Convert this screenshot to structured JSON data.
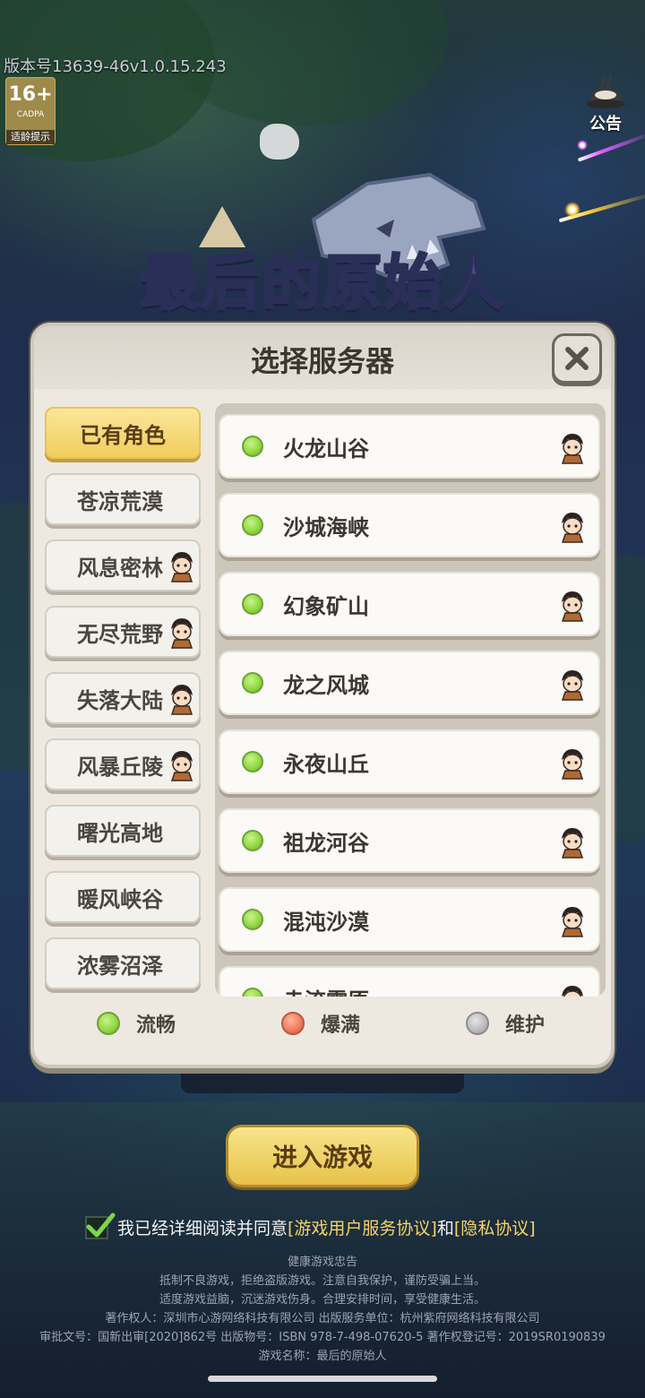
{
  "version": "版本号13639-46v1.0.15.243",
  "age_badge": {
    "rating": "16+",
    "org": "CADPA",
    "tip": "适龄提示"
  },
  "notice_label": "公告",
  "game_logo": "最后的原始人",
  "dialog": {
    "title": "选择服务器",
    "regions": [
      {
        "label": "已有角色",
        "active": true,
        "has_role": false
      },
      {
        "label": "苍凉荒漠",
        "active": false,
        "has_role": false
      },
      {
        "label": "风息密林",
        "active": false,
        "has_role": true
      },
      {
        "label": "无尽荒野",
        "active": false,
        "has_role": true
      },
      {
        "label": "失落大陆",
        "active": false,
        "has_role": true
      },
      {
        "label": "风暴丘陵",
        "active": false,
        "has_role": true
      },
      {
        "label": "曙光高地",
        "active": false,
        "has_role": false
      },
      {
        "label": "暖风峡谷",
        "active": false,
        "has_role": false
      },
      {
        "label": "浓雾沼泽",
        "active": false,
        "has_role": false
      }
    ],
    "servers": [
      {
        "name": "火龙山谷",
        "status": "流畅"
      },
      {
        "name": "沙城海峡",
        "status": "流畅"
      },
      {
        "name": "幻象矿山",
        "status": "流畅"
      },
      {
        "name": "龙之风城",
        "status": "流畅"
      },
      {
        "name": "永夜山丘",
        "status": "流畅"
      },
      {
        "name": "祖龙河谷",
        "status": "流畅"
      },
      {
        "name": "混沌沙漠",
        "status": "流畅"
      },
      {
        "name": "赤流霜原",
        "status": "流畅"
      }
    ],
    "legend": [
      {
        "label": "流畅",
        "color": "#8fd640"
      },
      {
        "label": "爆满",
        "color": "#f07a5a"
      },
      {
        "label": "维护",
        "color": "#b9b9b9"
      }
    ]
  },
  "behind_server_label": "",
  "enter_button": "进入游戏",
  "agreement": {
    "prefix": "我已经详细阅读并同意",
    "link1": "[游戏用户服务协议]",
    "and": "和",
    "link2": "[隐私协议]"
  },
  "footer": [
    "健康游戏忠告",
    "抵制不良游戏，拒绝盗版游戏。注意自我保护，谨防受骗上当。",
    "适度游戏益脑，沉迷游戏伤身。合理安排时间，享受健康生活。",
    "著作权人：深圳市心游网络科技有限公司 出版服务单位：杭州紫府网络科技有限公司",
    "审批文号：国新出审[2020]862号 出版物号：ISBN 978-7-498-07620-5 著作权登记号：2019SR0190839",
    "游戏名称：最后的原始人"
  ],
  "colors": {
    "status_smooth": "#8fd640",
    "status_full": "#f07a5a",
    "status_maintenance": "#b9b9b9",
    "active_tab": "#f1cd5c",
    "link": "#f4d36a"
  }
}
